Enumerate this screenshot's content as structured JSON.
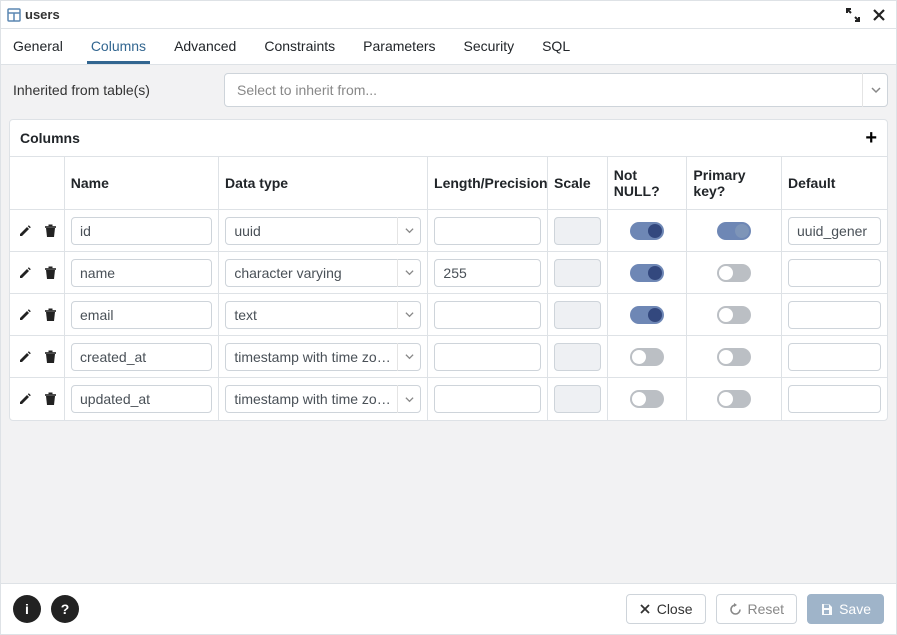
{
  "header": {
    "title": "users"
  },
  "tabs": [
    "General",
    "Columns",
    "Advanced",
    "Constraints",
    "Parameters",
    "Security",
    "SQL"
  ],
  "active_tab": "Columns",
  "inherit": {
    "label": "Inherited from table(s)",
    "placeholder": "Select to inherit from..."
  },
  "panel": {
    "title": "Columns",
    "headers": {
      "name": "Name",
      "data_type": "Data type",
      "length": "Length/Precision",
      "scale": "Scale",
      "not_null": "Not NULL?",
      "primary_key": "Primary key?",
      "default": "Default"
    }
  },
  "columns": [
    {
      "name": "id",
      "data_type": "uuid",
      "length": "",
      "scale": "",
      "scale_disabled": true,
      "not_null": true,
      "primary_key": true,
      "default": "uuid_gener"
    },
    {
      "name": "name",
      "data_type": "character varying",
      "length": "255",
      "scale": "",
      "scale_disabled": true,
      "not_null": true,
      "primary_key": false,
      "default": ""
    },
    {
      "name": "email",
      "data_type": "text",
      "length": "",
      "scale": "",
      "scale_disabled": true,
      "not_null": true,
      "primary_key": false,
      "default": ""
    },
    {
      "name": "created_at",
      "data_type": "timestamp with time zo…",
      "length": "",
      "scale": "",
      "scale_disabled": true,
      "not_null": false,
      "primary_key": false,
      "default": ""
    },
    {
      "name": "updated_at",
      "data_type": "timestamp with time zo…",
      "length": "",
      "scale": "",
      "scale_disabled": true,
      "not_null": false,
      "primary_key": false,
      "default": ""
    }
  ],
  "footer": {
    "close": "Close",
    "reset": "Reset",
    "save": "Save"
  }
}
